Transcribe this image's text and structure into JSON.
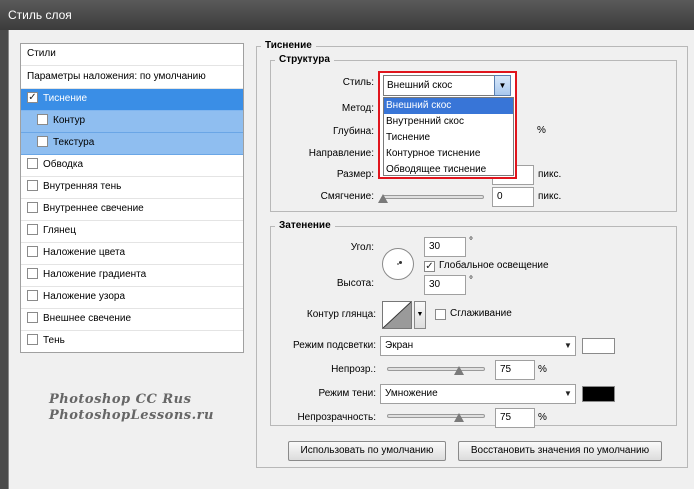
{
  "window_title": "Стиль слоя",
  "left_panel": {
    "header": "Стили",
    "blend_default": "Параметры наложения: по умолчанию",
    "items": [
      {
        "label": "Тиснение",
        "checked": true,
        "state": "selected"
      },
      {
        "label": "Контур",
        "checked": false,
        "state": "sub"
      },
      {
        "label": "Текстура",
        "checked": false,
        "state": "sub"
      },
      {
        "label": "Обводка",
        "checked": false
      },
      {
        "label": "Внутренняя тень",
        "checked": false
      },
      {
        "label": "Внутреннее свечение",
        "checked": false
      },
      {
        "label": "Глянец",
        "checked": false
      },
      {
        "label": "Наложение цвета",
        "checked": false
      },
      {
        "label": "Наложение градиента",
        "checked": false
      },
      {
        "label": "Наложение узора",
        "checked": false
      },
      {
        "label": "Внешнее свечение",
        "checked": false
      },
      {
        "label": "Тень",
        "checked": false
      }
    ],
    "watermark_line1": "Photoshop CC Rus",
    "watermark_line2": "PhotoshopLessons.ru"
  },
  "bevel": {
    "group_title": "Тиснение",
    "structure": {
      "title": "Структура",
      "style_label": "Стиль:",
      "style_value": "Внешний скос",
      "method_label": "Метод:",
      "depth_label": "Глубина:",
      "depth_unit": "%",
      "direction_label": "Направление:",
      "size_label": "Размер:",
      "size_unit": "пикс.",
      "soften_label": "Смягчение:",
      "soften_value": "0",
      "soften_unit": "пикс."
    },
    "style_options": [
      "Внешний скос",
      "Внутренний скос",
      "Тиснение",
      "Контурное тиснение",
      "Обводящее тиснение"
    ],
    "shading": {
      "title": "Затенение",
      "angle_label": "Угол:",
      "angle_value": "30",
      "degree": "°",
      "global_light_label": "Глобальное освещение",
      "global_light_checked": true,
      "altitude_label": "Высота:",
      "altitude_value": "30",
      "gloss_contour_label": "Контур глянца:",
      "antialias_label": "Сглаживание",
      "highlight_mode_label": "Режим подсветки:",
      "highlight_mode_value": "Экран",
      "highlight_color": "#ffffff",
      "highlight_opacity_label": "Непрозр.:",
      "highlight_opacity_value": "75",
      "highlight_opacity_unit": "%",
      "shadow_mode_label": "Режим тени:",
      "shadow_mode_value": "Умножение",
      "shadow_color": "#000000",
      "shadow_opacity_label": "Непрозрачность:",
      "shadow_opacity_value": "75",
      "shadow_opacity_unit": "%"
    },
    "make_default_button": "Использовать по умолчанию",
    "reset_default_button": "Восстановить значения по умолчанию"
  }
}
